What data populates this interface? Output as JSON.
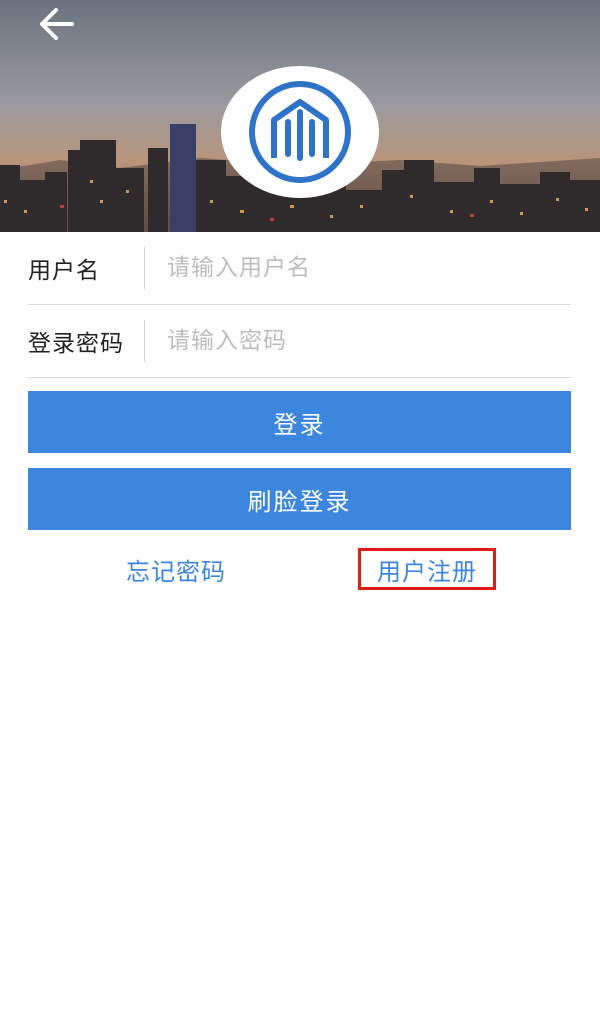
{
  "form": {
    "username_label": "用户名",
    "username_placeholder": "请输入用户名",
    "password_label": "登录密码",
    "password_placeholder": "请输入密码"
  },
  "buttons": {
    "login": "登录",
    "face_login": "刷脸登录"
  },
  "links": {
    "forgot_password": "忘记密码",
    "register": "用户注册"
  },
  "colors": {
    "primary": "#3c86e0",
    "highlight_border": "#e11a1a"
  },
  "icons": {
    "back": "back-arrow-icon",
    "logo": "app-logo"
  }
}
